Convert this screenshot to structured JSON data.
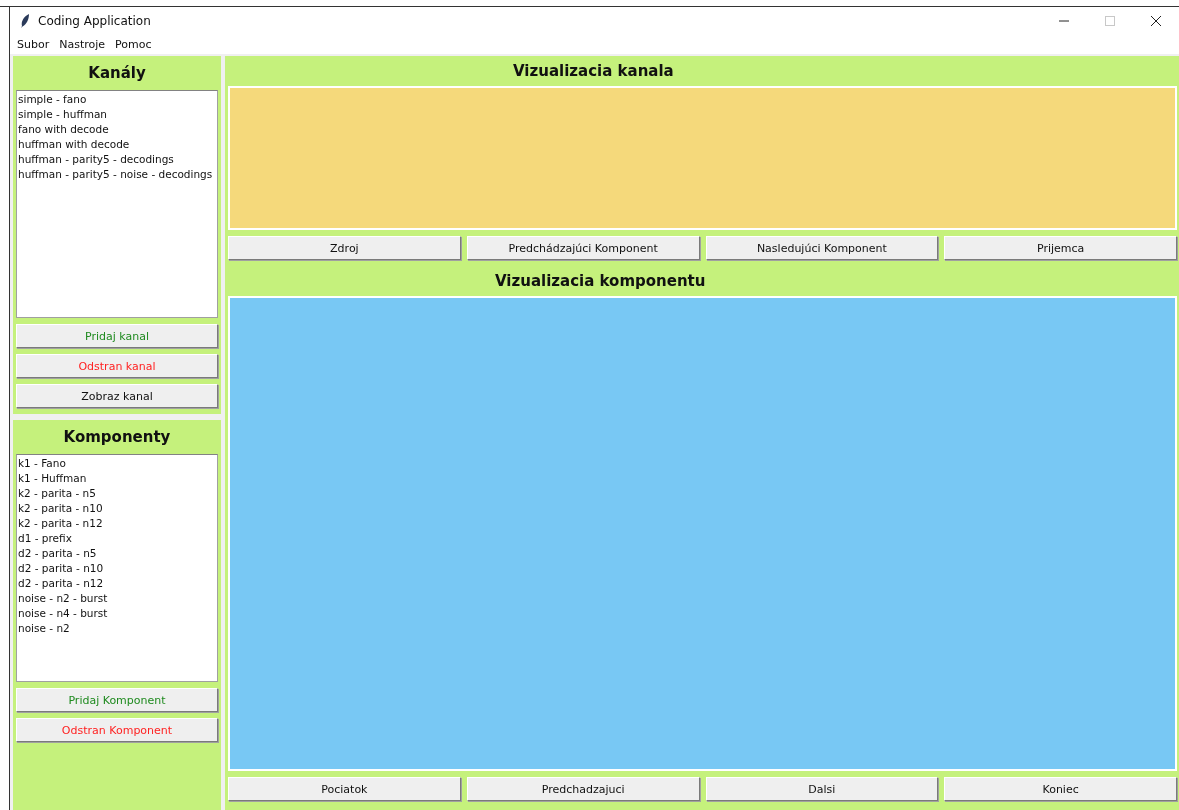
{
  "window": {
    "title": "Coding Application",
    "controls": [
      {
        "kind": "minimize",
        "disabled": false
      },
      {
        "kind": "maximize",
        "disabled": true
      },
      {
        "kind": "close",
        "disabled": false
      }
    ]
  },
  "menu": [
    "Subor",
    "Nastroje",
    "Pomoc"
  ],
  "sidebar": {
    "sections": [
      {
        "title": "Kanály",
        "items": [
          "simple - fano",
          "simple - huffman",
          "fano with decode",
          "huffman with decode",
          "huffman - parity5 - decodings",
          "huffman - parity5 - noise - decodings"
        ],
        "buttons": [
          {
            "label": "Pridaj kanal",
            "kind": "add"
          },
          {
            "label": "Odstran kanal",
            "kind": "remove"
          },
          {
            "label": "Zobraz kanal",
            "kind": "plain"
          }
        ]
      },
      {
        "title": "Komponenty",
        "items": [
          "k1 - Fano",
          "k1 - Huffman",
          "k2 - parita - n5",
          "k2 - parita - n10",
          "k2 - parita - n12",
          "d1 - prefix",
          "d2 - parita - n5",
          "d2 - parita - n10",
          "d2 - parita - n12",
          "noise - n2 - burst",
          "noise - n4 - burst",
          "noise - n2"
        ],
        "buttons": [
          {
            "label": "Pridaj Komponent",
            "kind": "add"
          },
          {
            "label": "Odstran Komponent",
            "kind": "remove"
          }
        ]
      }
    ]
  },
  "channel_view": {
    "title": "Vizualizacia kanala",
    "buttons": [
      "Zdroj",
      "Predchádzajúci Komponent",
      "Nasledujúci Komponent",
      "Prijemca"
    ]
  },
  "component_view": {
    "title": "Vizualizacia komponentu",
    "buttons": [
      "Pociatok",
      "Predchadzajuci",
      "Dalsi",
      "Koniec"
    ]
  }
}
